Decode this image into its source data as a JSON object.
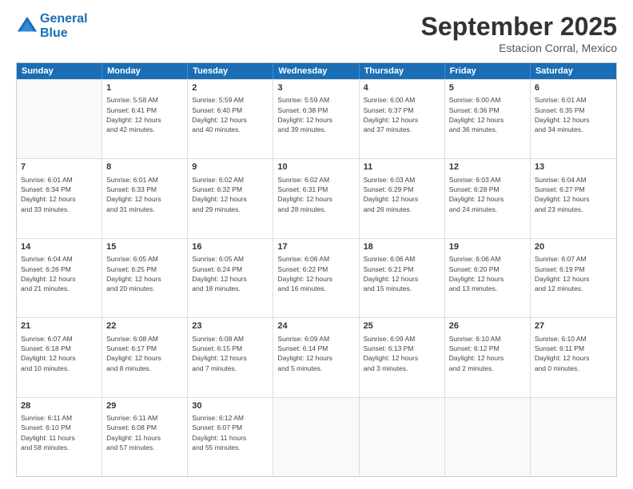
{
  "app": {
    "logo_line1": "General",
    "logo_line2": "Blue"
  },
  "header": {
    "month": "September 2025",
    "location": "Estacion Corral, Mexico"
  },
  "weekdays": [
    "Sunday",
    "Monday",
    "Tuesday",
    "Wednesday",
    "Thursday",
    "Friday",
    "Saturday"
  ],
  "weeks": [
    [
      {
        "day": "",
        "info": ""
      },
      {
        "day": "1",
        "info": "Sunrise: 5:58 AM\nSunset: 6:41 PM\nDaylight: 12 hours\nand 42 minutes."
      },
      {
        "day": "2",
        "info": "Sunrise: 5:59 AM\nSunset: 6:40 PM\nDaylight: 12 hours\nand 40 minutes."
      },
      {
        "day": "3",
        "info": "Sunrise: 5:59 AM\nSunset: 6:38 PM\nDaylight: 12 hours\nand 39 minutes."
      },
      {
        "day": "4",
        "info": "Sunrise: 6:00 AM\nSunset: 6:37 PM\nDaylight: 12 hours\nand 37 minutes."
      },
      {
        "day": "5",
        "info": "Sunrise: 6:00 AM\nSunset: 6:36 PM\nDaylight: 12 hours\nand 36 minutes."
      },
      {
        "day": "6",
        "info": "Sunrise: 6:01 AM\nSunset: 6:35 PM\nDaylight: 12 hours\nand 34 minutes."
      }
    ],
    [
      {
        "day": "7",
        "info": "Sunrise: 6:01 AM\nSunset: 6:34 PM\nDaylight: 12 hours\nand 33 minutes."
      },
      {
        "day": "8",
        "info": "Sunrise: 6:01 AM\nSunset: 6:33 PM\nDaylight: 12 hours\nand 31 minutes."
      },
      {
        "day": "9",
        "info": "Sunrise: 6:02 AM\nSunset: 6:32 PM\nDaylight: 12 hours\nand 29 minutes."
      },
      {
        "day": "10",
        "info": "Sunrise: 6:02 AM\nSunset: 6:31 PM\nDaylight: 12 hours\nand 28 minutes."
      },
      {
        "day": "11",
        "info": "Sunrise: 6:03 AM\nSunset: 6:29 PM\nDaylight: 12 hours\nand 26 minutes."
      },
      {
        "day": "12",
        "info": "Sunrise: 6:03 AM\nSunset: 6:28 PM\nDaylight: 12 hours\nand 24 minutes."
      },
      {
        "day": "13",
        "info": "Sunrise: 6:04 AM\nSunset: 6:27 PM\nDaylight: 12 hours\nand 23 minutes."
      }
    ],
    [
      {
        "day": "14",
        "info": "Sunrise: 6:04 AM\nSunset: 6:26 PM\nDaylight: 12 hours\nand 21 minutes."
      },
      {
        "day": "15",
        "info": "Sunrise: 6:05 AM\nSunset: 6:25 PM\nDaylight: 12 hours\nand 20 minutes."
      },
      {
        "day": "16",
        "info": "Sunrise: 6:05 AM\nSunset: 6:24 PM\nDaylight: 12 hours\nand 18 minutes."
      },
      {
        "day": "17",
        "info": "Sunrise: 6:06 AM\nSunset: 6:22 PM\nDaylight: 12 hours\nand 16 minutes."
      },
      {
        "day": "18",
        "info": "Sunrise: 6:06 AM\nSunset: 6:21 PM\nDaylight: 12 hours\nand 15 minutes."
      },
      {
        "day": "19",
        "info": "Sunrise: 6:06 AM\nSunset: 6:20 PM\nDaylight: 12 hours\nand 13 minutes."
      },
      {
        "day": "20",
        "info": "Sunrise: 6:07 AM\nSunset: 6:19 PM\nDaylight: 12 hours\nand 12 minutes."
      }
    ],
    [
      {
        "day": "21",
        "info": "Sunrise: 6:07 AM\nSunset: 6:18 PM\nDaylight: 12 hours\nand 10 minutes."
      },
      {
        "day": "22",
        "info": "Sunrise: 6:08 AM\nSunset: 6:17 PM\nDaylight: 12 hours\nand 8 minutes."
      },
      {
        "day": "23",
        "info": "Sunrise: 6:08 AM\nSunset: 6:15 PM\nDaylight: 12 hours\nand 7 minutes."
      },
      {
        "day": "24",
        "info": "Sunrise: 6:09 AM\nSunset: 6:14 PM\nDaylight: 12 hours\nand 5 minutes."
      },
      {
        "day": "25",
        "info": "Sunrise: 6:09 AM\nSunset: 6:13 PM\nDaylight: 12 hours\nand 3 minutes."
      },
      {
        "day": "26",
        "info": "Sunrise: 6:10 AM\nSunset: 6:12 PM\nDaylight: 12 hours\nand 2 minutes."
      },
      {
        "day": "27",
        "info": "Sunrise: 6:10 AM\nSunset: 6:11 PM\nDaylight: 12 hours\nand 0 minutes."
      }
    ],
    [
      {
        "day": "28",
        "info": "Sunrise: 6:11 AM\nSunset: 6:10 PM\nDaylight: 11 hours\nand 58 minutes."
      },
      {
        "day": "29",
        "info": "Sunrise: 6:11 AM\nSunset: 6:08 PM\nDaylight: 11 hours\nand 57 minutes."
      },
      {
        "day": "30",
        "info": "Sunrise: 6:12 AM\nSunset: 6:07 PM\nDaylight: 11 hours\nand 55 minutes."
      },
      {
        "day": "",
        "info": ""
      },
      {
        "day": "",
        "info": ""
      },
      {
        "day": "",
        "info": ""
      },
      {
        "day": "",
        "info": ""
      }
    ]
  ]
}
